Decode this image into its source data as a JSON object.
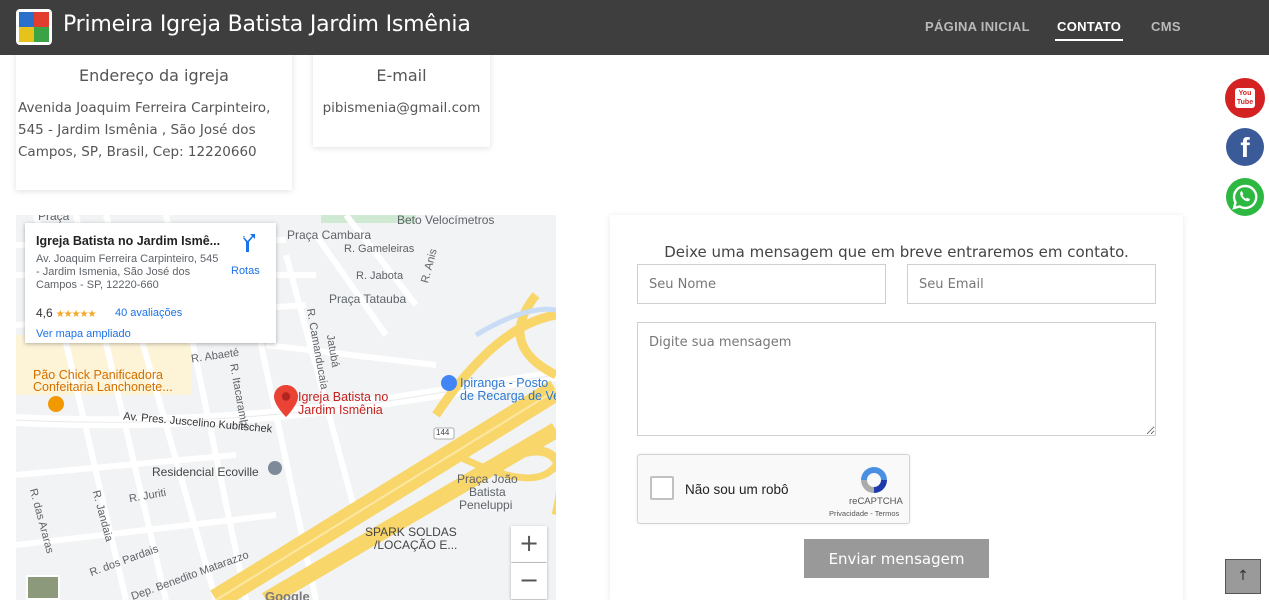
{
  "header": {
    "site_title": "Primeira Igreja Batista Jardim Ismênia",
    "nav": {
      "home": "PÁGINA INICIAL",
      "contact": "CONTATO",
      "cms": "CMS"
    },
    "active_nav": "CONTATO"
  },
  "cards": {
    "address": {
      "title": "Endereço da igreja",
      "text": "Avenida Joaquim Ferreira Carpinteiro, 545 - Jardim Ismênia , São José dos Campos, SP, Brasil, Cep: 12220660"
    },
    "email": {
      "title": "E-mail",
      "text": "pibismenia@gmail.com"
    }
  },
  "social": [
    {
      "name": "YouTube",
      "icon": "youtube-icon",
      "label": "You Tube",
      "color": "#d42222"
    },
    {
      "name": "Facebook",
      "icon": "facebook-icon",
      "label": "f",
      "color": "#3b5a98"
    },
    {
      "name": "WhatsApp",
      "icon": "whatsapp-icon",
      "color": "#2db842"
    }
  ],
  "map": {
    "info": {
      "title": "Igreja Batista no Jardim Ismê...",
      "address": "Av. Joaquim Ferreira Carpinteiro, 545 - Jardim Ismenia, São José dos Campos - SP, 12220-660",
      "rating": "4,6",
      "stars": "★★★★★",
      "reviews": "40 avaliações",
      "directions": "Rotas",
      "larger_map": "Ver mapa ampliado"
    },
    "labels": {
      "praca_top": "Praça",
      "beto": "Beto Velocímetros",
      "praca_cambara": "Praça Cambara",
      "gameleiras": "R. Gameleiras",
      "jabota": "R. Jabota",
      "anis": "R. Anis",
      "praca_tatauba": "Praça Tatauba",
      "camanducaia": "R. Camanducaia",
      "jatuba": "Jatubá",
      "abaete": "R. Abaeté",
      "itacarambi": "R. Itacarambi",
      "pao_chick": "Pão Chick Panificadora",
      "confeitaria": "Confeitaria Lanchonete...",
      "church_1": "Igreja Batista no",
      "church_2": "Jardim Ismênia",
      "ipiranga_1": "Ipiranga - Posto",
      "ipiranga_2": "de Recarga de Ve",
      "juscelino": "Av. Pres. Juscelino Kubitschek",
      "route_144": "144",
      "residencial": "Residencial Ecoville",
      "joao_1": "Praça João",
      "joao_2": "Batista",
      "joao_3": "Peneluppi",
      "jurit": "R. Juriti",
      "jandaia": "R. Jandaia",
      "araras": "R. das Araras",
      "pardais": "R. dos Pardais",
      "matarazzo": "Dep. Benedito Matarazzo",
      "spark_1": "SPARK SOLDAS",
      "spark_2": "/LOCAÇÃO E...",
      "google": "Google"
    },
    "zoom_in": "+",
    "zoom_out": "−"
  },
  "form": {
    "heading": "Deixe uma mensagem que em breve entraremos em contato.",
    "name_placeholder": "Seu Nome",
    "email_placeholder": "Seu Email",
    "message_placeholder": "Digite sua mensagem",
    "captcha_label": "Não sou um robô",
    "captcha_brand": "reCAPTCHA",
    "captcha_terms": "Privacidade - Termos",
    "submit": "Enviar mensagem"
  },
  "back_to_top": "↑"
}
